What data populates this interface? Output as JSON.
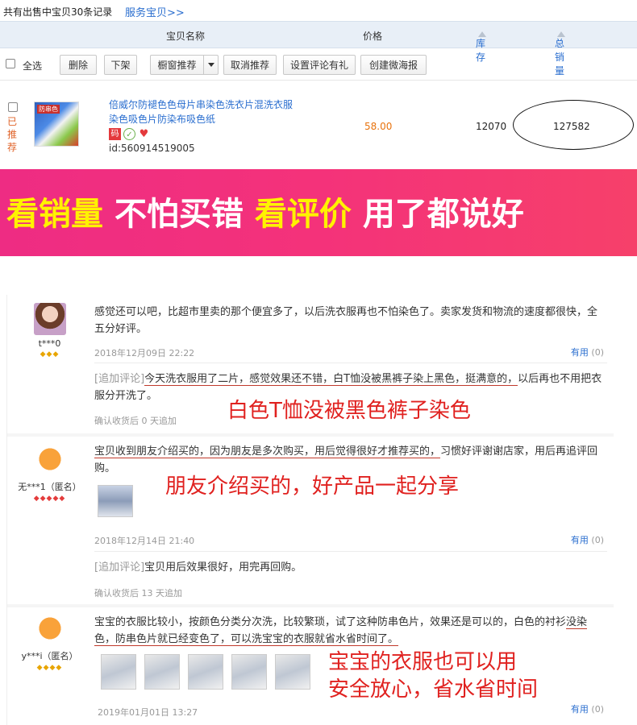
{
  "header": {
    "count_text": "共有出售中宝贝30条记录",
    "service_link": "服务宝贝>>"
  },
  "table_header": {
    "name": "宝贝名称",
    "price": "价格",
    "stock": "库存",
    "sales": "总销量"
  },
  "toolbar": {
    "select_all": "全选",
    "delete": "删除",
    "unlist": "下架",
    "window_recommend": "橱窗推荐",
    "cancel_recommend": "取消推荐",
    "set_review_gift": "设置评论有礼",
    "create_poster": "创建微海报"
  },
  "item": {
    "recommended": "已推荐",
    "thumb_text": "防串色",
    "title": "倍威尔防褪色色母片串染色洗衣片混洗衣服染色吸色片防染布吸色纸",
    "badge_ma": "码",
    "id": "id:560914519005",
    "price": "58.00",
    "stock": "12070",
    "sales": "127582"
  },
  "banner": {
    "part1": "看销量",
    "part2": "不怕买错",
    "part3": "看评价",
    "part4": "用了都说好"
  },
  "reviews": [
    {
      "user": "t***0",
      "text": "感觉还可以吧，比超市里卖的那个便宜多了，以后洗衣服再也不怕染色了。卖家发货和物流的速度都很快，全五分好评。",
      "date": "2018年12月09日 22:22",
      "useful_label": "有用",
      "useful_count": "(0)",
      "additional_tag": "[追加评论]",
      "additional_underlined": "今天洗衣服用了二片，感觉效果还不错，白T恤没被黑裤子染上黑色，挺满意的，",
      "additional_rest": "以后再也不用把衣服分开洗了。",
      "confirm": "确认收货后 0 天追加",
      "callout": "白色T恤没被黑色裤子染色"
    },
    {
      "user": "无***1（匿名）",
      "text_underlined": "宝贝收到朋友介绍买的，因为朋友是多次购买，用后觉得很好才推荐买的，",
      "text_rest": "习惯好评谢谢店家，用后再追评回购。",
      "date": "2018年12月14日 21:40",
      "useful_label": "有用",
      "useful_count": "(0)",
      "additional_tag": "[追加评论]",
      "additional_text": "宝贝用后效果很好，用完再回购。",
      "confirm": "确认收货后 13 天追加",
      "callout": "朋友介绍买的，好产品一起分享"
    },
    {
      "user": "y***i（匿名）",
      "text_part1": "宝宝的衣服比较小，按颜色分类分次洗，比较繁琐，试了这种防串色片，效果还是可以的，白色的衬衫",
      "text_underlined": "没染色，防串色片就已经变色了，可以洗宝宝的衣服就省水省时间了。",
      "date": "2019年01月01日 13:27",
      "useful_label": "有用",
      "useful_count": "(0)",
      "callout_line1": "宝宝的衣服也可以用",
      "callout_line2": "安全放心，省水省时间"
    }
  ],
  "colors": {
    "link_blue": "#2a6ecf",
    "price_orange": "#e8720c",
    "banner_pink": "#f4327a",
    "banner_yellow": "#fff200",
    "callout_red": "#e0211f"
  }
}
